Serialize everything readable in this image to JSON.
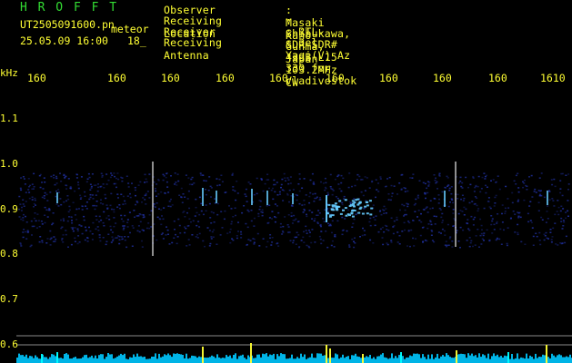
{
  "header": {
    "logo_text": "H R O F F T",
    "file_name": "UT2505091600.pn",
    "file_type": "meteor",
    "datetime": "25.05.09 16:00",
    "count": "18_"
  },
  "info": [
    {
      "key": "Observer",
      "value": ": Masaki Kano"
    },
    {
      "key": "Receiving Location",
      "value": ": Shibukawa, Gunma, Japan"
    },
    {
      "key": "Receiver",
      "value": ": RTL-SDR SDR# 43dB L15 103.2MHz CW"
    },
    {
      "key": "Receiving Antenna",
      "value": ": 3el Yagi(V) Az 330 for Vladivostok"
    }
  ],
  "axes": {
    "y_unit": "kHz",
    "y_ticks": [
      "1.1",
      "1.0",
      "0.9",
      "0.8",
      "0.7",
      "0.6"
    ],
    "x_ticks": [
      "160",
      "160",
      "160",
      "160",
      "160",
      "160",
      "160",
      "160",
      "160",
      "1610"
    ]
  },
  "colors": {
    "background": "#000000",
    "text": "#ffff33",
    "logo": "#33dd33",
    "noise_band": "#2233aa",
    "signal": "#66ccff",
    "spectrum": "#00c8ff",
    "hline": "#8a8a8a",
    "vline": "#ffffff"
  }
}
